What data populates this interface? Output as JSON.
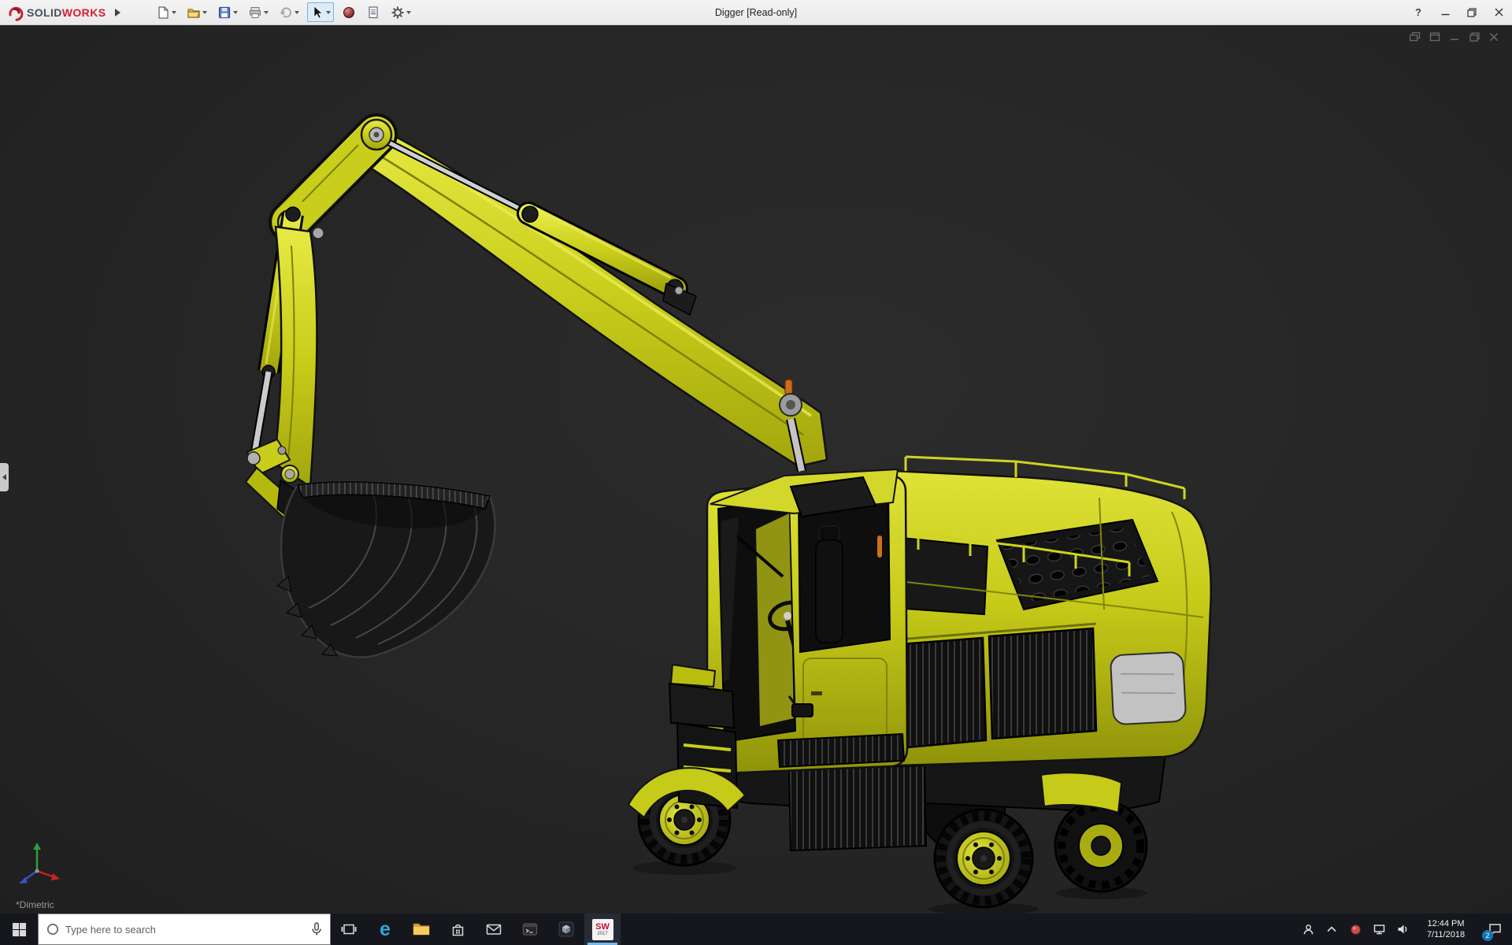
{
  "colors": {
    "viewport_background": "#262626",
    "excavator_yellow": "#c6ca18",
    "brand_red": "#d11f32",
    "taskbar_background": "#15171c",
    "titlebar_background": "#ececec",
    "active_app_accent": "#76b9ed",
    "badge_blue": "#1375b8"
  },
  "titlebar": {
    "brand_solid": "SOLID",
    "brand_works": "WORKS",
    "document_title": "Digger [Read-only]",
    "help_glyph": "?",
    "tool_icons": [
      "new-document",
      "open",
      "save",
      "print",
      "undo",
      "select-arrow",
      "appearance-sphere",
      "file-properties",
      "options-gear"
    ]
  },
  "viewport": {
    "view_label": "*Dimetric"
  },
  "taskbar": {
    "search_placeholder": "Type here to search",
    "clock": {
      "time": "12:44 PM",
      "date": "7/11/2018"
    },
    "notification_badge": "2",
    "sw_icon_text": "SW",
    "sw_icon_year": "2017"
  },
  "icons": {
    "edge_glyph": "e"
  }
}
